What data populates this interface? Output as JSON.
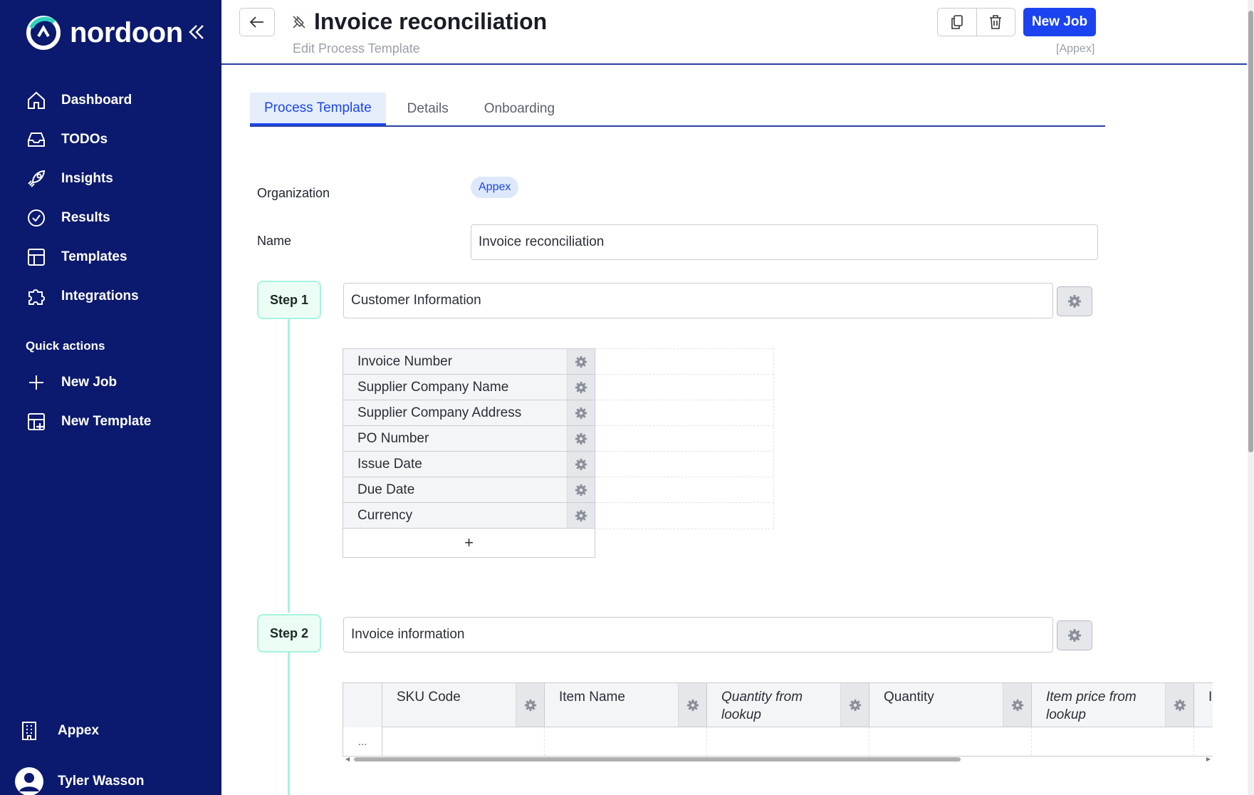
{
  "app": {
    "brand": "nordoon"
  },
  "sidebar": {
    "nav": [
      {
        "label": "Dashboard",
        "icon": "home-icon"
      },
      {
        "label": "TODOs",
        "icon": "inbox-icon"
      },
      {
        "label": "Insights",
        "icon": "rocket-icon"
      },
      {
        "label": "Results",
        "icon": "check-circle-icon"
      },
      {
        "label": "Templates",
        "icon": "table-icon"
      },
      {
        "label": "Integrations",
        "icon": "puzzle-icon"
      }
    ],
    "quick_actions_title": "Quick actions",
    "quick_actions": [
      {
        "label": "New Job",
        "icon": "plus-icon"
      },
      {
        "label": "New Template",
        "icon": "table-plus-icon"
      }
    ],
    "organization": "Appex",
    "user": "Tyler Wasson"
  },
  "header": {
    "title": "Invoice reconciliation",
    "subtitle": "Edit Process Template",
    "new_job_label": "New Job",
    "org_tag": "[Appex]"
  },
  "tabs": [
    {
      "label": "Process Template",
      "active": true
    },
    {
      "label": "Details",
      "active": false
    },
    {
      "label": "Onboarding",
      "active": false
    }
  ],
  "form": {
    "organization_label": "Organization",
    "organization_value": "Appex",
    "name_label": "Name",
    "name_value": "Invoice reconciliation"
  },
  "steps": [
    {
      "label": "Step 1",
      "name": "Customer Information",
      "fields": [
        "Invoice Number",
        "Supplier Company Name",
        "Supplier Company Address",
        "PO Number",
        "Issue Date",
        "Due Date",
        "Currency"
      ],
      "add_label": "+"
    },
    {
      "label": "Step 2",
      "name": "Invoice information",
      "columns": [
        {
          "label": "SKU Code",
          "italic": false
        },
        {
          "label": "Item Name",
          "italic": false
        },
        {
          "label": "Quantity from lookup",
          "italic": true
        },
        {
          "label": "Quantity",
          "italic": false
        },
        {
          "label": "Item price from lookup",
          "italic": true
        },
        {
          "label": "I",
          "italic": false
        }
      ],
      "row_label": "..."
    }
  ],
  "colors": {
    "sidebar_bg": "#0b1a6e",
    "primary": "#1b44f0",
    "step_accent": "#a7f3df"
  }
}
